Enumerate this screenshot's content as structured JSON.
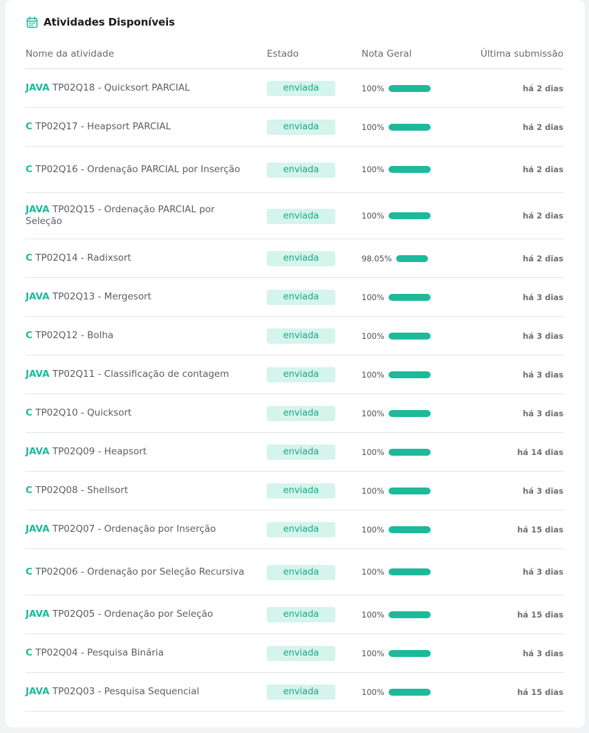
{
  "card": {
    "title": "Atividades Disponíveis",
    "icon": "calendar-icon",
    "accent": "#1db99a"
  },
  "table": {
    "headers": {
      "name": "Nome da atividade",
      "state": "Estado",
      "grade": "Nota Geral",
      "last": "Última submissão"
    },
    "rows": [
      {
        "lang": "JAVA",
        "title": "TP02Q18 - Quicksort PARCIAL",
        "state": "enviada",
        "grade": "100%",
        "fill": 1.0,
        "last": "há 2 dias"
      },
      {
        "lang": "C",
        "title": "TP02Q17 - Heapsort PARCIAL",
        "state": "enviada",
        "grade": "100%",
        "fill": 1.0,
        "last": "há 2 dias"
      },
      {
        "lang": "C",
        "title": "TP02Q16 - Ordenação PARCIAL por Inserção",
        "state": "enviada",
        "grade": "100%",
        "fill": 1.0,
        "last": "há 2 dias"
      },
      {
        "lang": "JAVA",
        "title": "TP02Q15 - Ordenação PARCIAL por Seleção",
        "state": "enviada",
        "grade": "100%",
        "fill": 1.0,
        "last": "há 2 dias"
      },
      {
        "lang": "C",
        "title": "TP02Q14 - Radixsort",
        "state": "enviada",
        "grade": "98.05%",
        "fill": 0.9805,
        "last": "há 2 dias"
      },
      {
        "lang": "JAVA",
        "title": "TP02Q13 - Mergesort",
        "state": "enviada",
        "grade": "100%",
        "fill": 1.0,
        "last": "há 3 dias"
      },
      {
        "lang": "C",
        "title": "TP02Q12 - Bolha",
        "state": "enviada",
        "grade": "100%",
        "fill": 1.0,
        "last": "há 3 dias"
      },
      {
        "lang": "JAVA",
        "title": "TP02Q11 - Classificação de contagem",
        "state": "enviada",
        "grade": "100%",
        "fill": 1.0,
        "last": "há 3 dias"
      },
      {
        "lang": "C",
        "title": "TP02Q10 - Quicksort",
        "state": "enviada",
        "grade": "100%",
        "fill": 1.0,
        "last": "há 3 dias"
      },
      {
        "lang": "JAVA",
        "title": "TP02Q09 - Heapsort",
        "state": "enviada",
        "grade": "100%",
        "fill": 1.0,
        "last": "há 14 dias"
      },
      {
        "lang": "C",
        "title": "TP02Q08 - Shellsort",
        "state": "enviada",
        "grade": "100%",
        "fill": 1.0,
        "last": "há 3 dias"
      },
      {
        "lang": "JAVA",
        "title": "TP02Q07 - Ordenação por Inserção",
        "state": "enviada",
        "grade": "100%",
        "fill": 1.0,
        "last": "há 15 dias"
      },
      {
        "lang": "C",
        "title": "TP02Q06 - Ordenação por Seleção Recursiva",
        "state": "enviada",
        "grade": "100%",
        "fill": 1.0,
        "last": "há 3 dias"
      },
      {
        "lang": "JAVA",
        "title": "TP02Q05 - Ordenação por Seleção",
        "state": "enviada",
        "grade": "100%",
        "fill": 1.0,
        "last": "há 15 dias"
      },
      {
        "lang": "C",
        "title": "TP02Q04 - Pesquisa Binária",
        "state": "enviada",
        "grade": "100%",
        "fill": 1.0,
        "last": "há 3 dias"
      },
      {
        "lang": "JAVA",
        "title": "TP02Q03 - Pesquisa Sequencial",
        "state": "enviada",
        "grade": "100%",
        "fill": 1.0,
        "last": "há 15 dias"
      }
    ]
  }
}
